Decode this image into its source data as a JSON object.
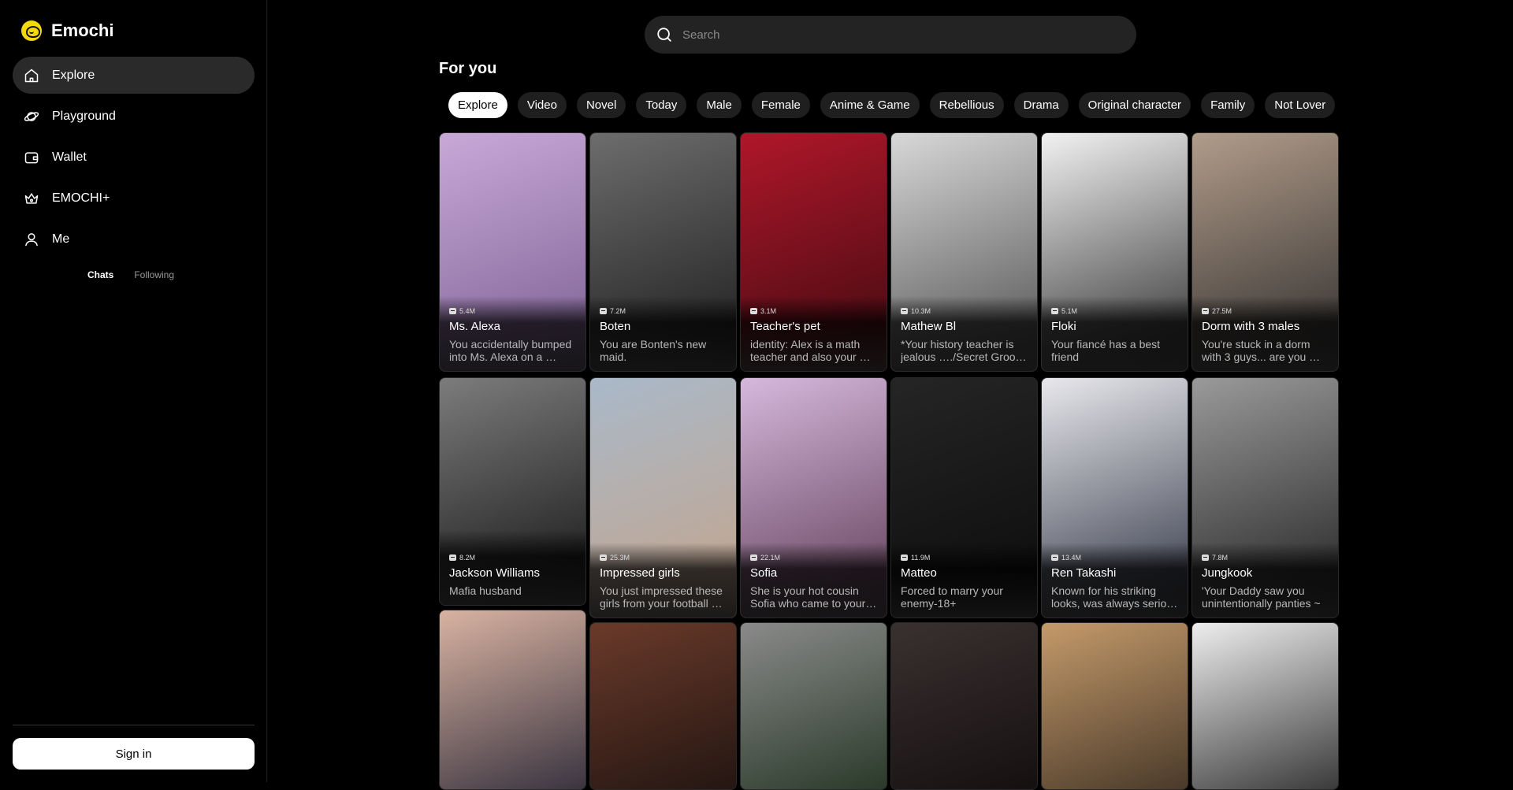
{
  "brand": {
    "name": "Emochi"
  },
  "nav": [
    {
      "label": "Explore",
      "icon": "home-icon",
      "active": true
    },
    {
      "label": "Playground",
      "icon": "planet-icon",
      "active": false
    },
    {
      "label": "Wallet",
      "icon": "wallet-icon",
      "active": false
    },
    {
      "label": "EMOCHI+",
      "icon": "crown-icon",
      "active": false
    },
    {
      "label": "Me",
      "icon": "user-icon",
      "active": false
    }
  ],
  "subtabs": [
    {
      "label": "Chats",
      "active": true
    },
    {
      "label": "Following",
      "active": false
    }
  ],
  "signin_label": "Sign in",
  "search": {
    "placeholder": "Search"
  },
  "section_title": "For you",
  "chips": [
    "Explore",
    "Video",
    "Novel",
    "Today",
    "Male",
    "Female",
    "Anime & Game",
    "Rebellious",
    "Drama",
    "Original character",
    "Family",
    "Not Lover",
    ""
  ],
  "cards": [
    {
      "count": "5.4M",
      "name": "Ms. Alexa",
      "desc": "You accidentally bumped into Ms. Alexa on a …",
      "colors": [
        "#c9a8d8",
        "#7a5f92"
      ]
    },
    {
      "count": "7.2M",
      "name": "Boten",
      "desc": "You are Bonten's new maid.",
      "colors": [
        "#6d6d6d",
        "#1b1b1b"
      ]
    },
    {
      "count": "3.1M",
      "name": "Teacher's pet",
      "desc": "identity: Alex is a math teacher and also your …",
      "colors": [
        "#b0172a",
        "#3e0a10"
      ]
    },
    {
      "count": "10.3M",
      "name": "Mathew Bl",
      "desc": "*Your history teacher is jealous …./Secret Groo…",
      "colors": [
        "#d8d8d8",
        "#4d4d4d"
      ]
    },
    {
      "count": "5.1M",
      "name": "Floki",
      "desc": "Your fiancé has a best friend",
      "colors": [
        "#f2f2f2",
        "#2a2a2a"
      ]
    },
    {
      "count": "27.5M",
      "name": "Dorm with 3 males",
      "desc": "You're stuck in a dorm with 3 guys... are you …",
      "colors": [
        "#b29c8a",
        "#2b2b2b"
      ]
    },
    {
      "count": "8.2M",
      "name": "Jackson Williams",
      "desc": "Mafia husband",
      "colors": [
        "#7c7c7c",
        "#141414"
      ]
    },
    {
      "count": "25.3M",
      "name": "Impressed girls",
      "desc": "You just impressed these girls from your football …",
      "colors": [
        "#a9b9c9",
        "#c4a38a"
      ]
    },
    {
      "count": "22.1M",
      "name": "Sofia",
      "desc": "She is your hot cousin Sofia who came to your …",
      "colors": [
        "#d6b8dd",
        "#5b3a52"
      ]
    },
    {
      "count": "11.9M",
      "name": "Matteo",
      "desc": "Forced to marry your enemy-18+",
      "colors": [
        "#252525",
        "#0b0b0b"
      ]
    },
    {
      "count": "13.4M",
      "name": "Ren Takashi",
      "desc": "Known for his striking looks, was always serio…",
      "colors": [
        "#e8e8ec",
        "#2b3040"
      ]
    },
    {
      "count": "7.8M",
      "name": "Jungkook",
      "desc": "'Your Daddy saw you unintentionally panties ~",
      "colors": [
        "#9a9a9a",
        "#1e1e1e"
      ]
    },
    {
      "count": "",
      "name": "",
      "desc": "",
      "colors": [
        "#d9b3a2",
        "#3a3440"
      ]
    },
    {
      "count": "",
      "name": "",
      "desc": "",
      "colors": [
        "#6a3a2a",
        "#241612"
      ]
    },
    {
      "count": "",
      "name": "",
      "desc": "",
      "colors": [
        "#8a8a8a",
        "#2a3a2a"
      ]
    },
    {
      "count": "",
      "name": "",
      "desc": "",
      "colors": [
        "#3a3030",
        "#151010"
      ]
    },
    {
      "count": "",
      "name": "",
      "desc": "",
      "colors": [
        "#c49a6a",
        "#4a3a2a"
      ]
    },
    {
      "count": "",
      "name": "",
      "desc": "",
      "colors": [
        "#eeeeee",
        "#3a3a3a"
      ]
    }
  ]
}
